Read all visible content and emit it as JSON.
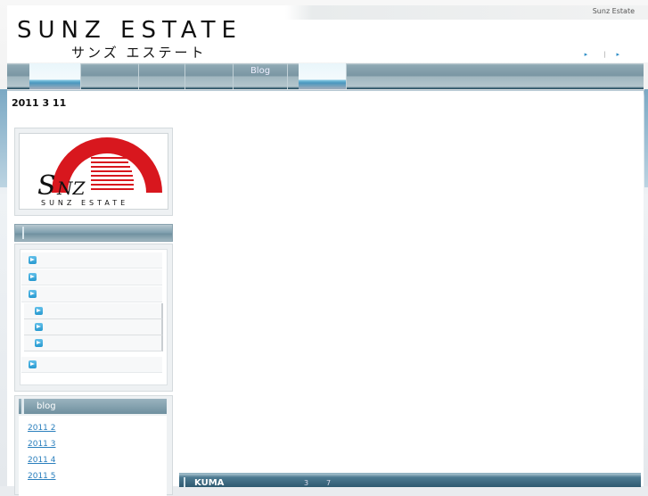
{
  "header": {
    "logo_en": "SUNZ ESTATE",
    "logo_ja": "サンズ エステート",
    "site_name": "Sunz Estate",
    "top_links": [
      "",
      ""
    ]
  },
  "nav": {
    "items": [
      {
        "label": "",
        "active": true
      },
      {
        "label": "",
        "active": false
      },
      {
        "label": "",
        "active": false
      },
      {
        "label": "",
        "active": false
      },
      {
        "label": "Blog",
        "active": false
      },
      {
        "label": "",
        "active": true
      }
    ]
  },
  "date_heading": "2011  3  11",
  "sidebar": {
    "logo_mark": "SNZ",
    "logo_caption": "SUNZ  ESTATE",
    "menu_items": [
      "",
      "",
      "",
      "",
      "",
      "",
      ""
    ],
    "blog_title": "blog",
    "blog_links": [
      "2011 2",
      "2011 3",
      "2011 4",
      "2011 5"
    ]
  },
  "footer_bar": {
    "label": "KUMA",
    "num1": "3",
    "num2": "7"
  },
  "colors": {
    "accent_blue": "#2799cf",
    "nav_bar": "#7a96a3",
    "logo_red": "#d8171e",
    "link": "#2a7fbd"
  }
}
